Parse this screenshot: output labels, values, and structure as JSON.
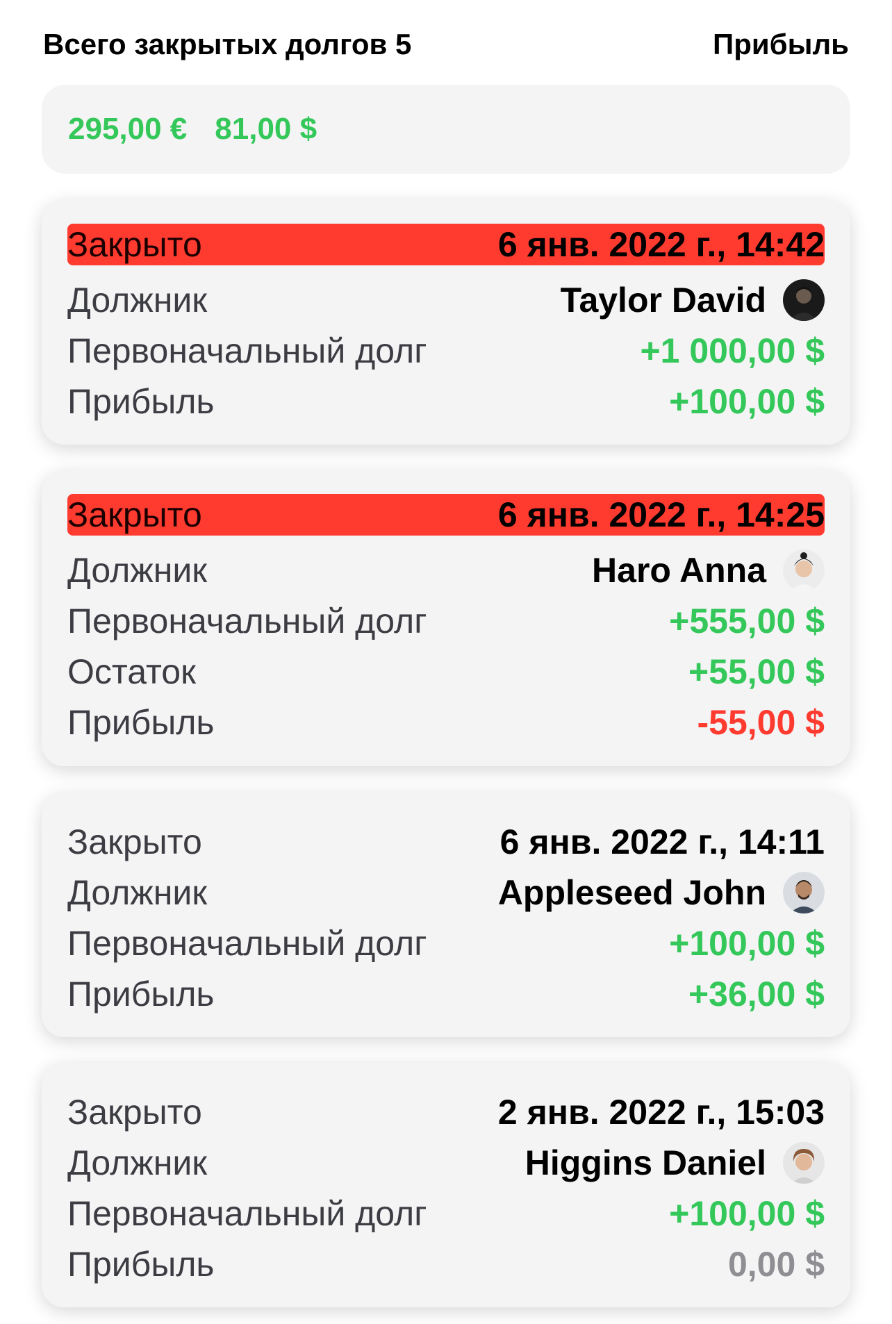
{
  "header": {
    "title": "Всего закрытых долгов 5",
    "right_label": "Прибыль"
  },
  "totals": {
    "eur": "295,00 €",
    "usd": "81,00 $"
  },
  "cards": [
    {
      "highlighted": true,
      "status_label": "Закрыто",
      "date": "6 янв. 2022 г., 14:42",
      "debtor_label": "Должник",
      "debtor_name": "Taylor David",
      "avatar": "person-photo-icon",
      "initial_label": "Первоначальный долг",
      "initial_value": "+1 000,00 $",
      "profit_label": "Прибыль",
      "profit_value": "+100,00 $"
    },
    {
      "highlighted": true,
      "status_label": "Закрыто",
      "date": "6 янв. 2022 г., 14:25",
      "debtor_label": "Должник",
      "debtor_name": "Haro Anna",
      "avatar": "person-photo-icon",
      "initial_label": "Первоначальный долг",
      "initial_value": "+555,00 $",
      "remainder_label": "Остаток",
      "remainder_value": "+55,00 $",
      "profit_label": "Прибыль",
      "profit_value": "-55,00 $"
    },
    {
      "highlighted": false,
      "status_label": "Закрыто",
      "date": "6 янв. 2022 г., 14:11",
      "debtor_label": "Должник",
      "debtor_name": "Appleseed John",
      "avatar": "person-photo-icon",
      "initial_label": "Первоначальный долг",
      "initial_value": "+100,00 $",
      "profit_label": "Прибыль",
      "profit_value": "+36,00 $"
    },
    {
      "highlighted": false,
      "status_label": "Закрыто",
      "date": "2 янв. 2022 г., 15:03",
      "debtor_label": "Должник",
      "debtor_name": "Higgins Daniel",
      "avatar": "person-photo-icon",
      "initial_label": "Первоначальный долг",
      "initial_value": "+100,00 $",
      "profit_label": "Прибыль",
      "profit_value": "0,00 $"
    }
  ],
  "colors": {
    "positive": "#34c759",
    "negative": "#ff3b30",
    "neutral": "#8e8e93",
    "highlight": "#ff3b30",
    "card_bg": "#f4f4f5"
  }
}
